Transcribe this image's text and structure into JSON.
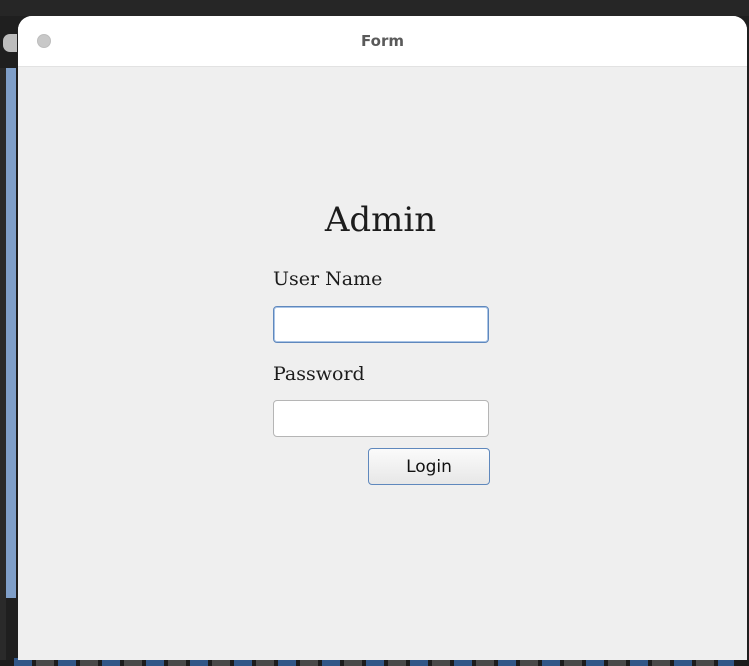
{
  "window": {
    "title": "Form"
  },
  "form": {
    "heading": "Admin",
    "username_label": "User Name",
    "username_value": "",
    "password_label": "Password",
    "password_value": "",
    "login_label": "Login"
  },
  "colors": {
    "window_bg": "#efefef",
    "titlebar_bg": "#ffffff",
    "focus_border": "#5f88bd"
  }
}
